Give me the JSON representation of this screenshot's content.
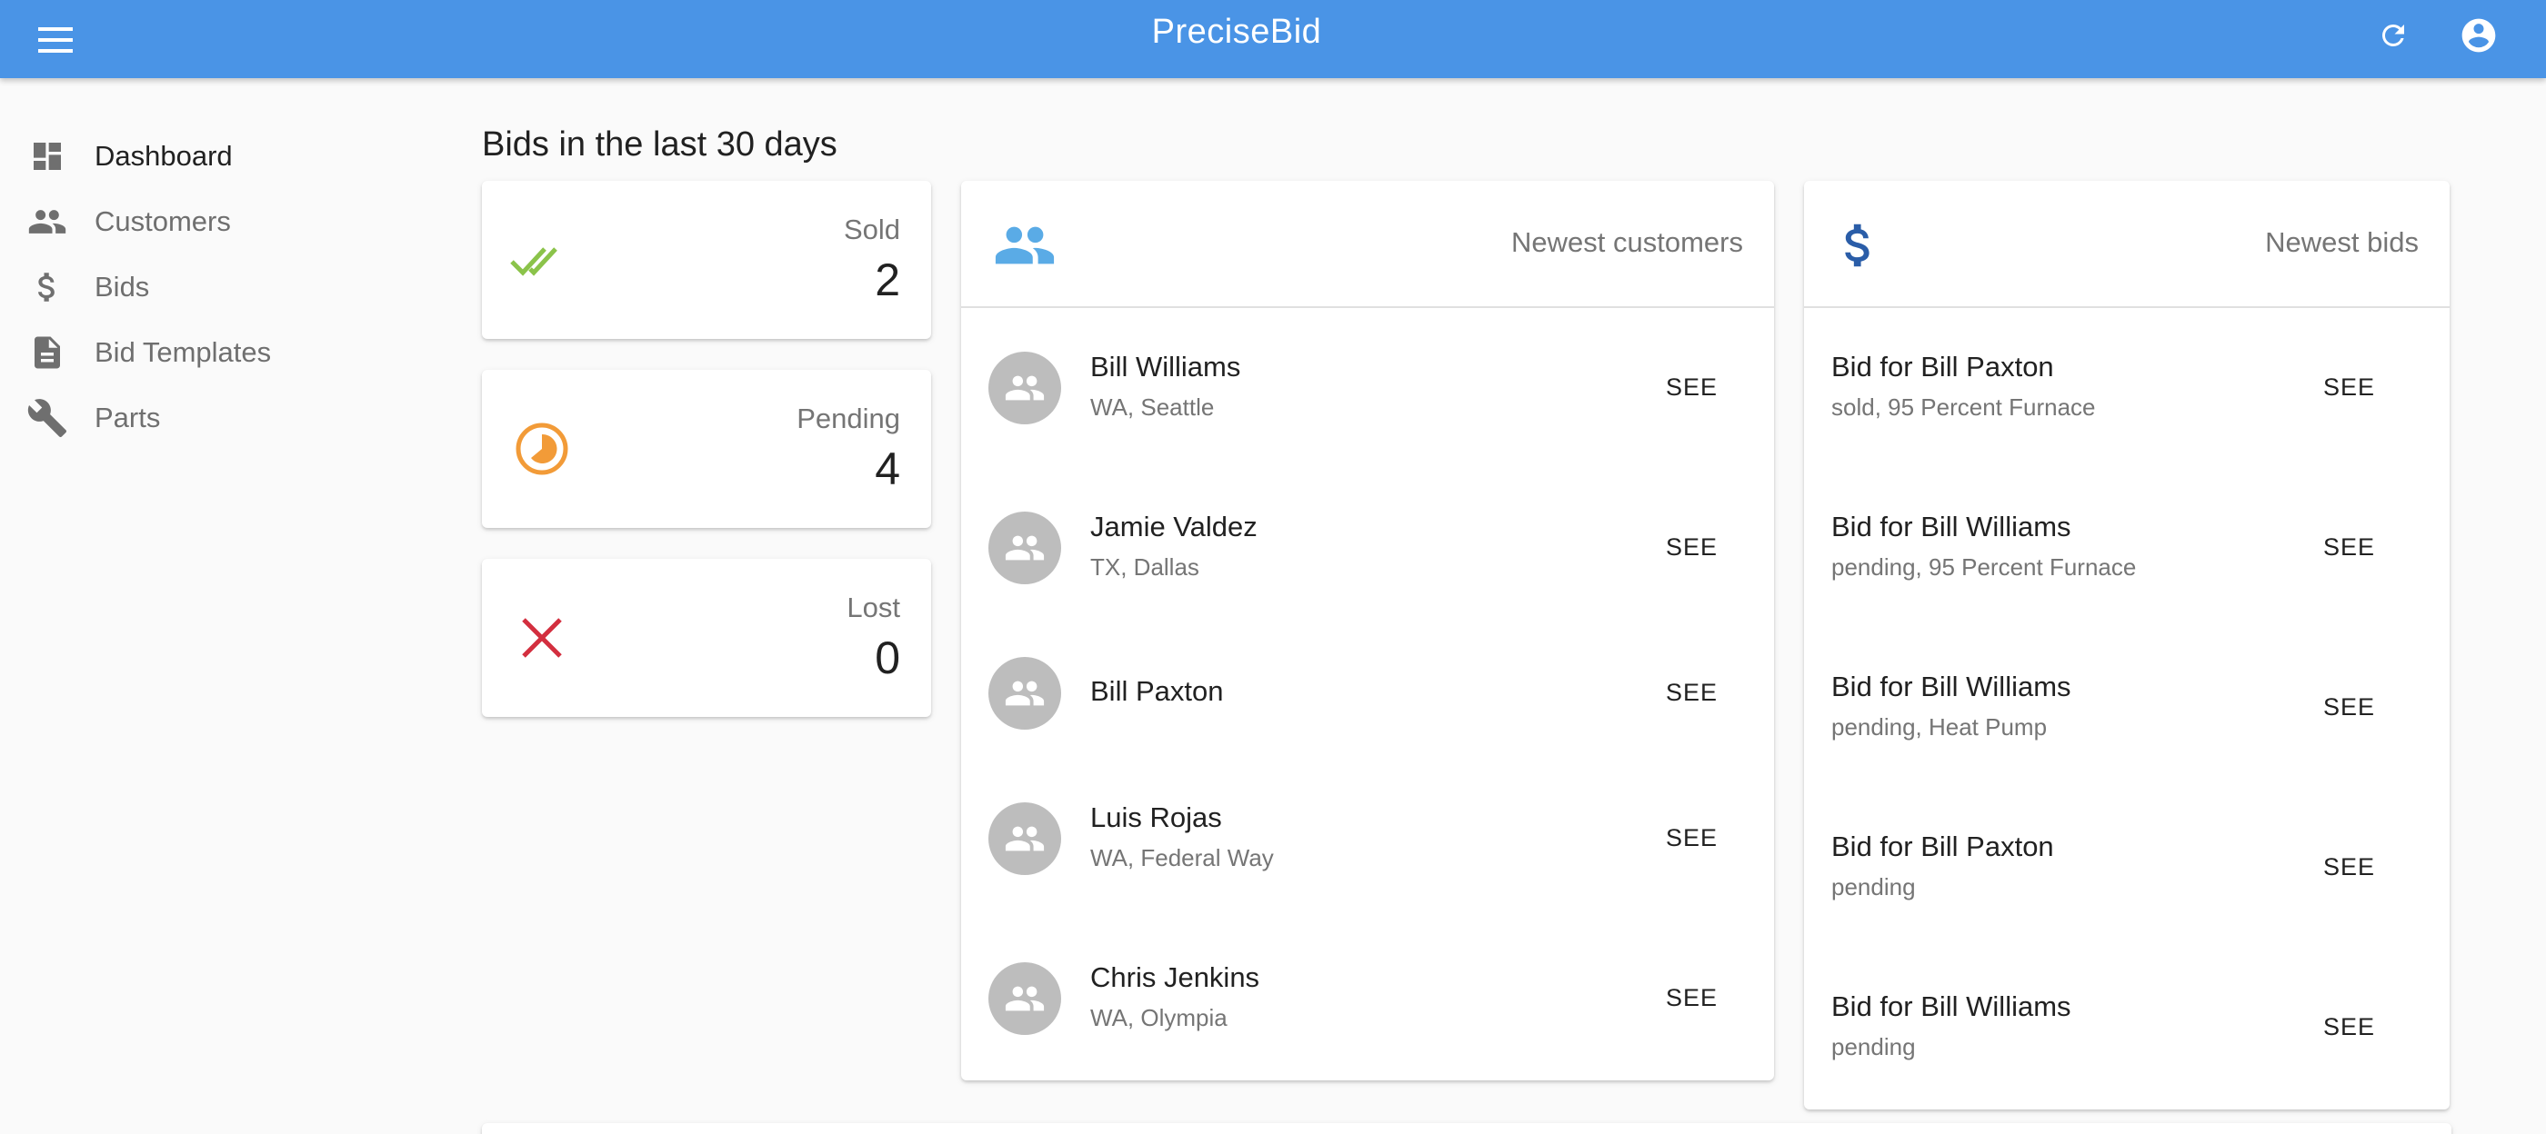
{
  "app": {
    "title": "PreciseBid",
    "icons": {
      "menu": "menu-icon",
      "refresh": "refresh-icon",
      "account": "account-circle-icon"
    }
  },
  "sidebar": {
    "items": [
      {
        "label": "Dashboard",
        "icon": "dashboard-icon",
        "active": true
      },
      {
        "label": "Customers",
        "icon": "people-icon",
        "active": false
      },
      {
        "label": "Bids",
        "icon": "dollar-icon",
        "active": false
      },
      {
        "label": "Bid Templates",
        "icon": "document-icon",
        "active": false
      },
      {
        "label": "Parts",
        "icon": "wrench-icon",
        "active": false
      }
    ]
  },
  "main": {
    "section_title": "Bids in the last 30 days",
    "stats": [
      {
        "label": "Sold",
        "value": "2",
        "icon": "double-check-icon",
        "color": "#8bc34a"
      },
      {
        "label": "Pending",
        "value": "4",
        "icon": "pending-clock-icon",
        "color": "#f29b38"
      },
      {
        "label": "Lost",
        "value": "0",
        "icon": "close-icon",
        "color": "#d32f3f"
      }
    ],
    "customers": {
      "title": "Newest customers",
      "icon": "people-icon",
      "icon_color": "#5aabe6",
      "items": [
        {
          "name": "Bill Williams",
          "location": "WA, Seattle",
          "action": "SEE"
        },
        {
          "name": "Jamie Valdez",
          "location": "TX, Dallas",
          "action": "SEE"
        },
        {
          "name": "Bill Paxton",
          "location": "",
          "action": "SEE"
        },
        {
          "name": "Luis Rojas",
          "location": "WA, Federal Way",
          "action": "SEE"
        },
        {
          "name": "Chris Jenkins",
          "location": "WA, Olympia",
          "action": "SEE"
        }
      ]
    },
    "bids": {
      "title": "Newest bids",
      "icon": "dollar-icon",
      "icon_color": "#2a5da8",
      "items": [
        {
          "title": "Bid for Bill Paxton",
          "detail": "sold, 95 Percent Furnace",
          "action": "SEE"
        },
        {
          "title": "Bid for Bill Williams",
          "detail": "pending, 95 Percent Furnace",
          "action": "SEE"
        },
        {
          "title": "Bid for Bill Williams",
          "detail": "pending, Heat Pump",
          "action": "SEE"
        },
        {
          "title": "Bid for Bill Paxton",
          "detail": "pending",
          "action": "SEE"
        },
        {
          "title": "Bid for Bill Williams",
          "detail": "pending",
          "action": "SEE"
        }
      ]
    }
  }
}
